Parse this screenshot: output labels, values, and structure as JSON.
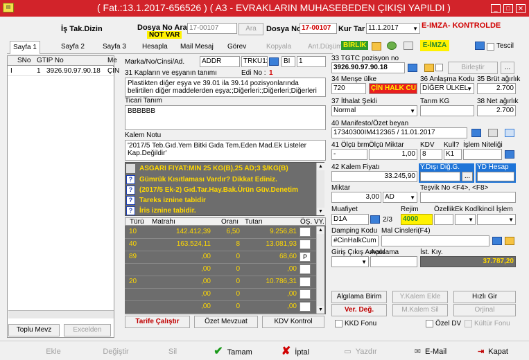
{
  "window": {
    "title": "( Fat.:13.1.2017-656526 ) ( A3  - EVRAKLARIN MUHASEBEDEN ÇIKIŞI YAPILDI )",
    "app_icon": "app-logo-icon",
    "buttons": [
      "_",
      "□",
      "x"
    ]
  },
  "header": {
    "is_takip": "İş Tak.Dizin",
    "dosya_no_ara_label": "Dosya No Ara",
    "dosya_no_ara_value": "17-00107",
    "not_var": "NOT VAR",
    "ara_button": "Ara",
    "dosya_no_label": "Dosya No",
    "dosya_no_value": "17-00107",
    "kur_tar_label": "Kur Tar",
    "kur_tar_value": "11.1.2017",
    "eimza_kontrol": "E-IMZA- KONTROLDE"
  },
  "tabs": [
    {
      "label": "Sayfa 1"
    },
    {
      "label": "Sayfa 2"
    },
    {
      "label": "Sayfa 3"
    },
    {
      "label": "Hesapla"
    },
    {
      "label": "Mail Mesaj"
    },
    {
      "label": "Görev"
    },
    {
      "label": "Kopyala"
    },
    {
      "label": "Ant.Düşüm"
    }
  ],
  "toolbar": {
    "birlik": "BİRLİK",
    "eimza": "E-İMZA",
    "tescil": "Tescil"
  },
  "left_list": {
    "columns": [
      "SNo",
      "GTIP No",
      "Me"
    ],
    "rows": [
      {
        "marker": "I",
        "sno": "1",
        "gtip": "3926.90.97.90.18",
        "me": "ÇİN"
      }
    ],
    "toplu_mevzuat": "Toplu Mevz",
    "excelden": "Excelden"
  },
  "item": {
    "marka_label": "Marka/No/Cinsi/Ad.",
    "marka_value": "ADDR",
    "trku_value": "TRKU12",
    "bi_value": "BI",
    "one_value": "1",
    "kaplar_label": "31 Kapların ve eşyanın tanımı",
    "edi_no_label": "Edi No :",
    "edi_no_value": "1",
    "esya_tanim": "Plastikten diğer eşya ve 39.01 ila 39.14 pozisyonlarında belirtilen diğer maddelerden eşya:;Diğerleri:;Diğerleri;Diğerleri",
    "ticari_tanim_label": "Ticari Tanım",
    "ticari_tanim_value": "BBBBBB",
    "kalem_notu_label": "Kalem Notu",
    "kalem_notu_value": "'2017/5 Teb.Gıd.Yem Bitki Gıda Tem.Eden Mad.Ek Listeler Kap.Değildir'"
  },
  "warnings": [
    "ASGARI FIYAT:MIN 25 KG(B),25 AD;3 $/KG(B)",
    "Gümrük Kısıtlaması Vardır? Dikkat Ediniz.",
    "(2017/5 Ek-2) Gıd.Tar.Hay.Bak.Ürün Güv.Denetim",
    "Tareks iznine tabidir",
    "İris iznine tabidir."
  ],
  "tax_table": {
    "headers": [
      "Türü",
      "Matrahı",
      "Oranı",
      "Tutarı",
      "ÖŞ.",
      "VY."
    ],
    "rows": [
      {
        "turu": "10",
        "matrah": "142.412,39",
        "oran": "6,50",
        "tutar": "9.256,81",
        "os": ""
      },
      {
        "turu": "40",
        "matrah": "163.524,11",
        "oran": "8",
        "tutar": "13.081,93",
        "os": ""
      },
      {
        "turu": "89",
        "matrah": ",00",
        "oran": "0",
        "tutar": "68,60",
        "os": "P"
      },
      {
        "turu": "",
        "matrah": ",00",
        "oran": "0",
        "tutar": ",00",
        "os": ""
      },
      {
        "turu": "20",
        "matrah": ",00",
        "oran": "0",
        "tutar": "10.786,31",
        "os": ""
      },
      {
        "turu": "",
        "matrah": ",00",
        "oran": "0",
        "tutar": ",00",
        "os": ""
      },
      {
        "turu": "",
        "matrah": ",00",
        "oran": "0",
        "tutar": ",00",
        "os": ""
      }
    ]
  },
  "bottom_left_buttons": {
    "tarife": "Tarife Çalıştır",
    "ozet_mevzuat": "Özet Mevzuat",
    "kdv_kontrol": "KDV Kontrol"
  },
  "right": {
    "gtip_label": "33 TGTC pozisyon no",
    "gtip_value": "3926.90.97.90.18",
    "birlestir": "Birleştir",
    "mense_label": "34 Menşe ülke",
    "mense_code": "720",
    "mense_value": "ÇİN HALK CU",
    "anlasma_label": "36 Anlaşma Kodu",
    "anlasma_value": "DİĞER ÜLKEL",
    "brut_label": "35 Brüt ağırlık",
    "brut_value": "2.700",
    "islem_label": "37 İthalat Şekli",
    "islem_value": "Normal",
    "tarim_label": "Tarım KG",
    "net_label": "38 Net ağırlık",
    "net_value": "2.700",
    "manifesto_label": "40 Manifesto/Özet beyan",
    "manifesto_value": "17340300IM412365 / 11.01.2017",
    "olcu_brm_label": "41 Ölçü brm",
    "olcu_brm_value": "-",
    "olcu_miktar_label": "Ölçü Miktar",
    "olcu_miktar_value": "1,00",
    "kdv_label": "KDV",
    "kdv_value": "8",
    "kull_label": "Kull?",
    "kull_value": "K1",
    "islem_nitelik_label": "İşlem Niteliği",
    "kalem_fiyat_label": "42 Kalem Fiyatı",
    "kalem_fiyat_value": "33.245,90",
    "ydisi_label": "Y.Dışı Diğ.G.",
    "yd_hesap_label": "YD Hesap",
    "miktar_label": "Miktar",
    "miktar_value": "3,00",
    "miktar_unit": "AD",
    "tesvik_label": "Teşvik No <F4>, <F8>",
    "muafiyet_label": "Muafiyet",
    "muafiyet_value": "D1A",
    "rejim_label": "Rejim",
    "rejim_value": "4000",
    "page_indicator": "2/3",
    "ozellik_label": "Özellik",
    "ek_kod_label": "Ek Kod",
    "ikincil_label": "İkincil İşlem",
    "damping_label": "Damping Kodu",
    "damping_value": "#CinHalkCum",
    "mal_cinsleri_label": "Mal Cinsleri(F4)",
    "giris_label": "Giriş Çıkış Amacı",
    "aciklama_label": "Açıklama",
    "ist_kiy_label": "İst. Kıy.",
    "ist_kiy_value": "37.787,20",
    "alg_birim": "Algılama Birim",
    "ykalem_ekle": "Y.Kalem Ekle",
    "hizli_gir": "Hızlı Gir",
    "ver_deg": "Ver. Değ.",
    "mkalem_sil": "M.Kalem Sil",
    "orjinal": "Orjinal",
    "kkd_fonu": "KKD Fonu",
    "ozel_dv": "Özel DV",
    "kultur_fonu": "Kültür Fonu"
  },
  "bottom_bar": {
    "ekle": "Ekle",
    "degistir": "Değiştir",
    "sil": "Sil",
    "tamam": "Tamam",
    "iptal": "İptal",
    "yazdir": "Yazdır",
    "email": "E-Mail",
    "kapat": "Kapat"
  },
  "colors": {
    "title_red": "#d2232a",
    "grid_gray": "#6d6d6d",
    "grid_text_yellow": "#ffd800",
    "blue_field": "#1e74d8",
    "eimza_yellow": "#fff200"
  }
}
